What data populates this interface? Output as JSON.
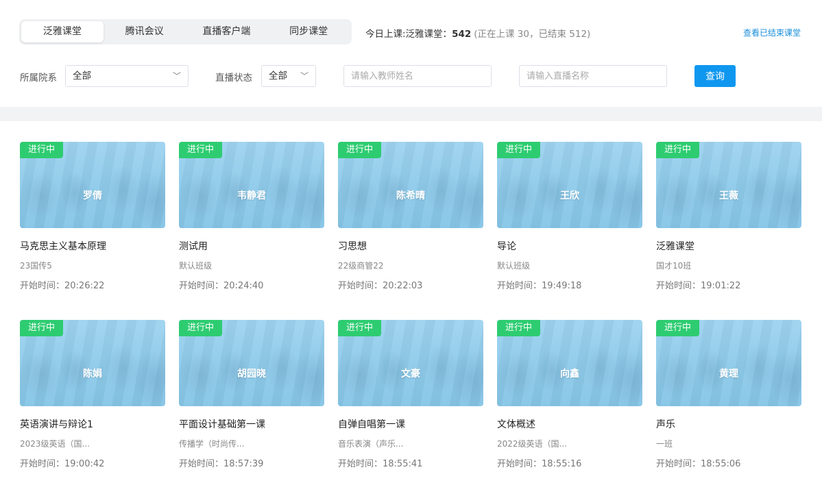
{
  "tabs": [
    {
      "label": "泛雅课堂",
      "active": true
    },
    {
      "label": "腾讯会议",
      "active": false
    },
    {
      "label": "直播客户端",
      "active": false
    },
    {
      "label": "同步课堂",
      "active": false
    }
  ],
  "today": {
    "label": "今日上课:泛雅课堂：",
    "count": "542",
    "detail": "(正在上课 30，已结束 512)"
  },
  "ended_link": "查看已结束课堂",
  "filters": {
    "department_label": "所属院系",
    "department_value": "全部",
    "status_label": "直播状态",
    "status_value": "全部",
    "teacher_placeholder": "请输入教师姓名",
    "live_name_placeholder": "请输入直播名称",
    "query_label": "查询"
  },
  "cards": [
    {
      "badge": "进行中",
      "teacher": "罗倩",
      "title": "马克思主义基本原理",
      "class": "23国传5",
      "start": "开始时间：20:26:22"
    },
    {
      "badge": "进行中",
      "teacher": "韦静君",
      "title": "测试用",
      "class": "默认班级",
      "start": "开始时间：20:24:40"
    },
    {
      "badge": "进行中",
      "teacher": "陈希晴",
      "title": "习思想",
      "class": "22级商管22",
      "start": "开始时间：20:22:03"
    },
    {
      "badge": "进行中",
      "teacher": "王欣",
      "title": "导论",
      "class": "默认班级",
      "start": "开始时间：19:49:18"
    },
    {
      "badge": "进行中",
      "teacher": "王薇",
      "title": "泛雅课堂",
      "class": "国才10班",
      "start": "开始时间：19:01:22"
    },
    {
      "badge": "进行中",
      "teacher": "陈娟",
      "title": "英语演讲与辩论1",
      "class": "2023级英语（国...",
      "start": "开始时间：19:00:42"
    },
    {
      "badge": "进行中",
      "teacher": "胡园晓",
      "title": "平面设计基础第一课",
      "class": "传播学（时尚传...",
      "start": "开始时间：18:57:39"
    },
    {
      "badge": "进行中",
      "teacher": "文豪",
      "title": "自弹自唱第一课",
      "class": "音乐表演（声乐...",
      "start": "开始时间：18:55:41"
    },
    {
      "badge": "进行中",
      "teacher": "向鑫",
      "title": "文体概述",
      "class": "2022级英语（国...",
      "start": "开始时间：18:55:16"
    },
    {
      "badge": "进行中",
      "teacher": "黄理",
      "title": "声乐",
      "class": "一班",
      "start": "开始时间：18:55:06"
    }
  ],
  "colors": {
    "badge_green": "#2ecc71",
    "primary_blue": "#0f97f0",
    "link_blue": "#1a8fd8",
    "thumb_blue": "#8fcbea"
  }
}
